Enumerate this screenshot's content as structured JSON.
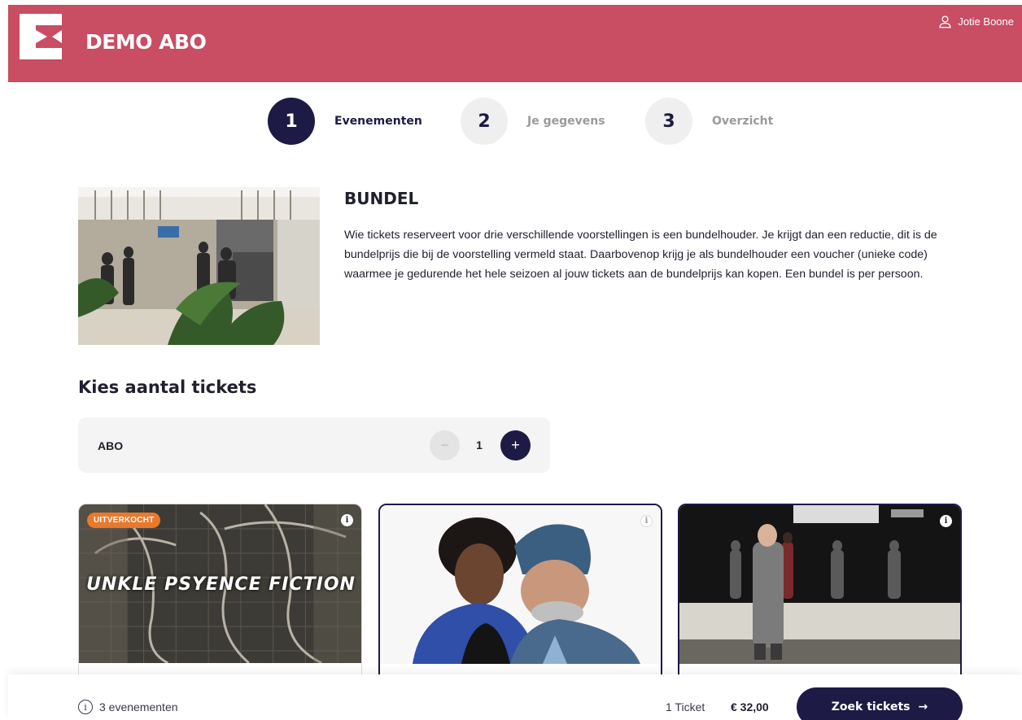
{
  "header": {
    "brand": "DEMO ABO",
    "user_name": "Jotie Boone",
    "user_icon": "user-icon",
    "logo": "brand-logo"
  },
  "stepper": [
    {
      "number": "1",
      "label": "Evenementen",
      "state": "active"
    },
    {
      "number": "2",
      "label": "Je gegevens",
      "state": "inactive"
    },
    {
      "number": "3",
      "label": "Overzicht",
      "state": "inactive"
    }
  ],
  "intro": {
    "title": "BUNDEL",
    "text": "Wie tickets reserveert voor drie verschillende voorstellingen is een bundelhouder. Je krijgt dan een reductie, dit is de bundelprijs die bij de voorstelling vermeld staat. Daarbovenop krijg je als bundelhouder een voucher (unieke code) waarmee je gedurende het hele seizoen al jouw tickets aan de bundelprijs kan kopen. Een bundel is per persoon."
  },
  "tickets": {
    "section_title": "Kies aantal tickets",
    "type_label": "ABO",
    "quantity": "1",
    "minus_symbol": "−",
    "plus_symbol": "+"
  },
  "events": [
    {
      "badge": "UITVERKOCHT",
      "art_text": "UNKLE PSYENCE FICTION",
      "info": "i"
    },
    {
      "info": "i"
    },
    {
      "info": "i"
    }
  ],
  "footer": {
    "event_count": "3 evenementen",
    "ticket_count": "1 Ticket",
    "price": "€ 32,00",
    "cta_label": "Zoek tickets",
    "cta_arrow": "→"
  },
  "colors": {
    "header": "#c94d63",
    "primary": "#1d1b45",
    "badge": "#e8792c"
  }
}
